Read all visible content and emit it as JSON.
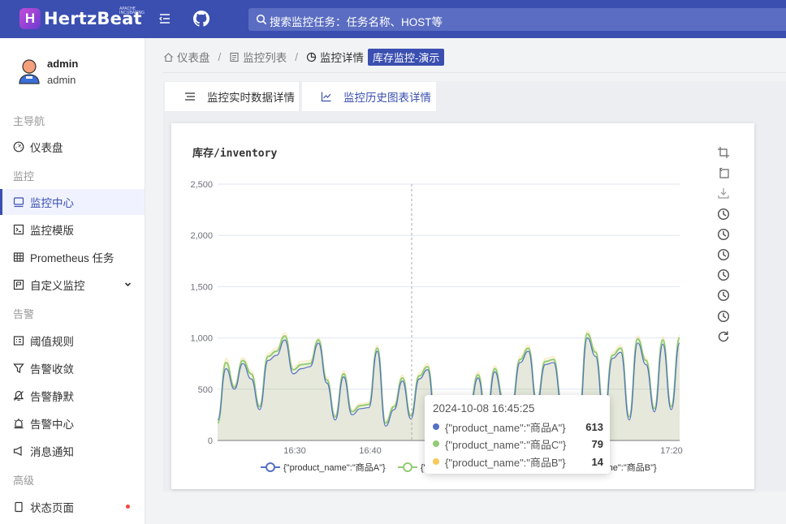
{
  "app": {
    "logo_letter": "H",
    "logo_text": "HertzBeat",
    "logo_badge": "APACHE INCUBATING"
  },
  "header": {
    "search_placeholder": "搜索监控任务：任务名称、HOST等"
  },
  "user": {
    "name": "admin",
    "role": "admin"
  },
  "sidebar": {
    "groups": [
      "主导航",
      "监控",
      "告警",
      "高级"
    ],
    "items": [
      {
        "label": "仪表盘",
        "icon": "dashboard-icon"
      },
      {
        "label": "监控中心",
        "icon": "monitor-icon"
      },
      {
        "label": "监控模版",
        "icon": "template-icon"
      },
      {
        "label": "Prometheus 任务",
        "icon": "table-icon"
      },
      {
        "label": "自定义监控",
        "icon": "custom-monitor-icon"
      },
      {
        "label": "阈值规则",
        "icon": "threshold-icon"
      },
      {
        "label": "告警收敛",
        "icon": "filter-icon"
      },
      {
        "label": "告警静默",
        "icon": "mute-icon"
      },
      {
        "label": "告警中心",
        "icon": "alarm-icon"
      },
      {
        "label": "消息通知",
        "icon": "notify-icon"
      },
      {
        "label": "状态页面",
        "icon": "status-page-icon"
      }
    ]
  },
  "breadcrumb": {
    "home": "仪表盘",
    "list": "监控列表",
    "current": "监控详情",
    "tag": "库存监控-演示"
  },
  "tabs": [
    {
      "label": "监控实时数据详情",
      "icon": "list-icon"
    },
    {
      "label": "监控历史图表详情",
      "icon": "line-chart-icon"
    }
  ],
  "colors": {
    "primary": "#3a4fb0",
    "series_a": "#5470c6",
    "series_c": "#91cc75",
    "series_b": "#fac858"
  },
  "chart_data": {
    "type": "area",
    "title": "库存/inventory",
    "x_ticks": [
      "16:30",
      "16:40",
      "17:20"
    ],
    "ylim": [
      0,
      2500
    ],
    "y_ticks": [
      0,
      500,
      1000,
      1500,
      2000,
      2500
    ],
    "y_tick_labels": [
      "0",
      "500",
      "1,000",
      "1,500",
      "2,000",
      "2,500"
    ],
    "grid": true,
    "legend_position": "bottom",
    "series": [
      {
        "name": "{\"product_name\":\"商品A\"}",
        "color": "#5470c6",
        "values": [
          200,
          700,
          500,
          750,
          600,
          300,
          780,
          830,
          980,
          650,
          700,
          720,
          950,
          560,
          200,
          620,
          250,
          310,
          320,
          870,
          140,
          300,
          580,
          210,
          600,
          690,
          130,
          270,
          130,
          360,
          310,
          610,
          200,
          670,
          380,
          310,
          760,
          870,
          350,
          740,
          760,
          330,
          290,
          180,
          1000,
          820,
          200,
          800,
          860,
          200,
          950,
          740,
          280,
          940,
          300,
          950
        ]
      },
      {
        "name": "{\"product_name\":\"商品C\"}",
        "color": "#91cc75",
        "values": [
          170,
          760,
          520,
          780,
          650,
          330,
          820,
          870,
          1020,
          690,
          740,
          750,
          980,
          590,
          230,
          650,
          280,
          340,
          350,
          900,
          170,
          330,
          610,
          240,
          630,
          720,
          160,
          300,
          160,
          390,
          340,
          640,
          230,
          700,
          410,
          340,
          790,
          900,
          380,
          770,
          790,
          360,
          320,
          210,
          1040,
          860,
          230,
          830,
          900,
          230,
          990,
          780,
          310,
          980,
          330,
          1000
        ]
      },
      {
        "name": "{\"product_name\":\"商品B\"}",
        "color": "#fac858",
        "values": [
          180,
          800,
          540,
          810,
          680,
          350,
          850,
          900,
          1050,
          720,
          770,
          780,
          1000,
          620,
          250,
          680,
          300,
          360,
          370,
          930,
          190,
          350,
          640,
          260,
          660,
          750,
          180,
          320,
          180,
          410,
          360,
          670,
          250,
          730,
          430,
          360,
          820,
          930,
          400,
          800,
          820,
          380,
          340,
          230,
          1070,
          890,
          250,
          860,
          930,
          250,
          1020,
          810,
          330,
          1010,
          350,
          1030
        ]
      }
    ],
    "tooltip": {
      "time": "2024-10-08 16:45:25",
      "rows": [
        {
          "name": "{\"product_name\":\"商品A\"}",
          "value": "613",
          "color": "#5470c6"
        },
        {
          "name": "{\"product_name\":\"商品C\"}",
          "value": "79",
          "color": "#91cc75"
        },
        {
          "name": "{\"product_name\":\"商品B\"}",
          "value": "14",
          "color": "#fac858"
        }
      ]
    },
    "legend": [
      "{\"product_name\":\"商品A\"}",
      "{\"product_name\":\"商品C\"}",
      "{\"product_name\":\"商品B\"}"
    ]
  }
}
